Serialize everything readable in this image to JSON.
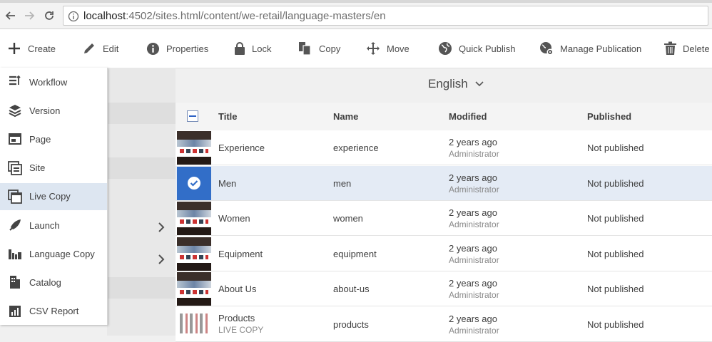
{
  "browser": {
    "url_host": "localhost",
    "url_rest": ":4502/sites.html/content/we-retail/language-masters/en"
  },
  "actions": {
    "create": "Create",
    "edit": "Edit",
    "properties": "Properties",
    "lock": "Lock",
    "copy": "Copy",
    "move": "Move",
    "quick_publish": "Quick Publish",
    "manage_publication": "Manage Publication",
    "delete": "Delete"
  },
  "create_menu": [
    {
      "label": "Workflow",
      "icon": "workflow-icon"
    },
    {
      "label": "Version",
      "icon": "layers-icon"
    },
    {
      "label": "Page",
      "icon": "page-icon"
    },
    {
      "label": "Site",
      "icon": "site-icon"
    },
    {
      "label": "Live Copy",
      "icon": "live-copy-icon",
      "highlighted": true
    },
    {
      "label": "Launch",
      "icon": "rocket-icon"
    },
    {
      "label": "Language Copy",
      "icon": "language-copy-icon"
    },
    {
      "label": "Catalog",
      "icon": "catalog-icon"
    },
    {
      "label": "CSV Report",
      "icon": "csv-report-icon"
    }
  ],
  "content": {
    "title": "English"
  },
  "table": {
    "headers": {
      "title": "Title",
      "name": "Name",
      "modified": "Modified",
      "published": "Published"
    },
    "rows": [
      {
        "title": "Experience",
        "subtitle": "",
        "name": "experience",
        "modified": "2 years ago",
        "modified_by": "Administrator",
        "published": "Not published",
        "selected": false
      },
      {
        "title": "Men",
        "subtitle": "",
        "name": "men",
        "modified": "2 years ago",
        "modified_by": "Administrator",
        "published": "Not published",
        "selected": true
      },
      {
        "title": "Women",
        "subtitle": "",
        "name": "women",
        "modified": "2 years ago",
        "modified_by": "Administrator",
        "published": "Not published",
        "selected": false
      },
      {
        "title": "Equipment",
        "subtitle": "",
        "name": "equipment",
        "modified": "2 years ago",
        "modified_by": "Administrator",
        "published": "Not published",
        "selected": false
      },
      {
        "title": "About Us",
        "subtitle": "",
        "name": "about-us",
        "modified": "2 years ago",
        "modified_by": "Administrator",
        "published": "Not published",
        "selected": false
      },
      {
        "title": "Products",
        "subtitle": "LIVE COPY",
        "name": "products",
        "modified": "2 years ago",
        "modified_by": "Administrator",
        "published": "Not published",
        "selected": false
      }
    ]
  },
  "colors": {
    "accent": "#326ec8",
    "highlight": "#dde6f1"
  }
}
